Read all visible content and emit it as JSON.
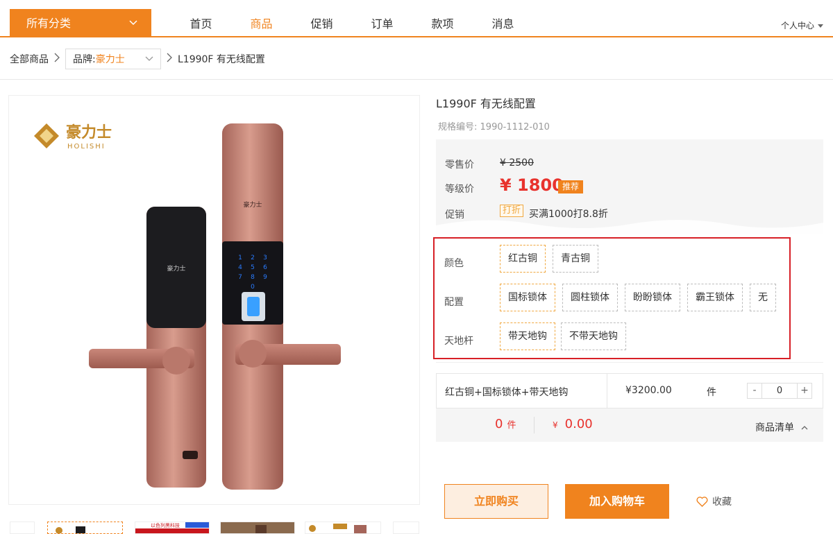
{
  "header": {
    "category_button": "所有分类",
    "nav": [
      "首页",
      "商品",
      "促销",
      "订单",
      "款项",
      "消息"
    ],
    "active_nav": "商品",
    "user_center": "个人中心",
    "accent_color": "#f0831e"
  },
  "breadcrumb": {
    "root": "全部商品",
    "brand_label": "品牌:",
    "brand_value": "豪力士",
    "current": "L1990F 有无线配置"
  },
  "gallery": {
    "brand_logo_cn": "豪力士",
    "brand_logo_en": "HOLISHI",
    "thumb_banner": "以色列黑科技"
  },
  "product": {
    "title": "L1990F 有无线配置",
    "code_label": "规格编号:",
    "code": "1990-1112-010",
    "retail_label": "零售价",
    "retail_price": "¥ 2500",
    "level_label": "等级价",
    "level_price": "¥ 1800",
    "level_tag": "推荐",
    "promo_label": "促销",
    "promo_tag": "打折",
    "promo_text": "买满1000打8.8折"
  },
  "specs": {
    "color_label": "颜色",
    "colors": [
      "红古铜",
      "青古铜"
    ],
    "config_label": "配置",
    "configs": [
      "国标锁体",
      "圆柱锁体",
      "盼盼锁体",
      "霸王锁体",
      "无"
    ],
    "rod_label": "天地杆",
    "rods": [
      "带天地钩",
      "不带天地钩"
    ],
    "highlight_color": "#d71f26"
  },
  "sku": {
    "name": "红古铜+国标锁体+带天地钩",
    "price": "¥3200.00",
    "unit": "件",
    "minus": "-",
    "qty": "0",
    "plus": "+"
  },
  "summary": {
    "qty": "0",
    "qty_unit": "件",
    "currency": "¥",
    "amount": "0.00",
    "list_label": "商品清单"
  },
  "actions": {
    "buy_now": "立即购买",
    "add_cart": "加入购物车",
    "favorite": "收藏"
  }
}
